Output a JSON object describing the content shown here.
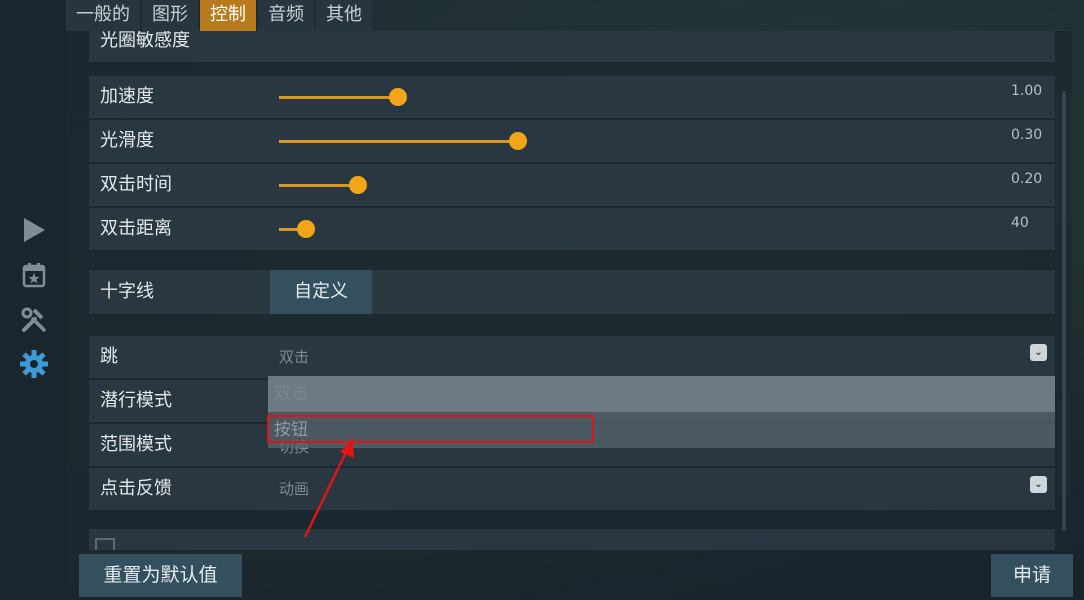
{
  "tabs": [
    "一般的",
    "图形",
    "控制",
    "音频",
    "其他"
  ],
  "active_tab": "控制",
  "partial_row": "光圈敏感度",
  "sliders": [
    {
      "label": "加速度",
      "value_text": "1.00",
      "fraction": 0.165
    },
    {
      "label": "光滑度",
      "value_text": "0.30",
      "fraction": 0.332
    },
    {
      "label": "双击时间",
      "value_text": "0.20",
      "fraction": 0.11
    },
    {
      "label": "双击距离",
      "value_text": "40",
      "fraction": 0.037
    }
  ],
  "crosshair": {
    "label": "十字线",
    "button": "自定义"
  },
  "selects": [
    {
      "label": "跳",
      "value": "双击"
    },
    {
      "label": "潜行模式",
      "value": ""
    },
    {
      "label": "范围模式",
      "value": "切换"
    },
    {
      "label": "点击反馈",
      "value": "动画"
    }
  ],
  "dropdown_options": [
    "双击",
    "按钮"
  ],
  "buttons": {
    "reset": "重置为默认值",
    "apply": "申请"
  },
  "colors": {
    "accent": "#f2a516",
    "active_tab": "#b87a1c",
    "highlight": "#e01414"
  },
  "icons": [
    "play-icon",
    "calendar-star-icon",
    "tools-icon",
    "gear-icon"
  ]
}
